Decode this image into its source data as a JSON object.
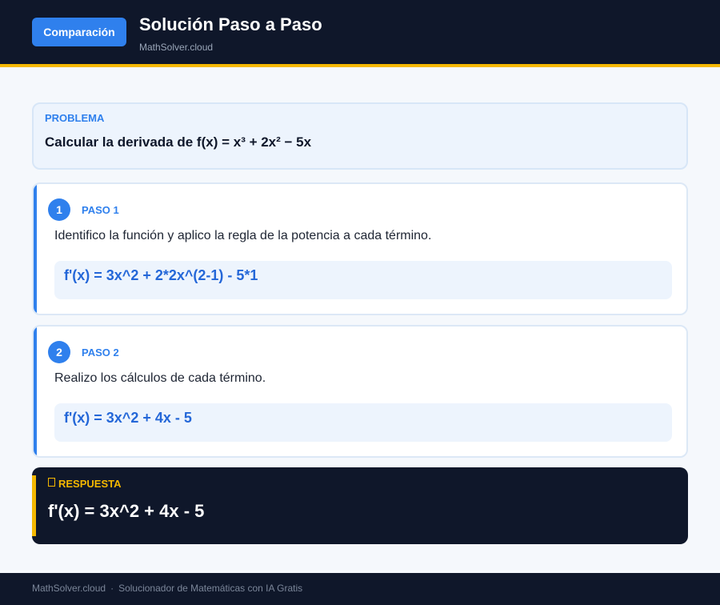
{
  "header": {
    "badge_label": "Comparación",
    "title": "Solución Paso a Paso",
    "subtitle": "MathSolver.cloud"
  },
  "problem": {
    "label": "PROBLEMA",
    "text": "Calcular la derivada de f(x) = x³ + 2x² − 5x"
  },
  "steps": [
    {
      "number": "1",
      "label": "PASO 1",
      "description": "Identifico la función y aplico la regla de la potencia a cada término.",
      "formula": "f'(x) = 3x^2 + 2*2x^(2-1) - 5*1"
    },
    {
      "number": "2",
      "label": "PASO 2",
      "description": "Realizo los cálculos de cada término.",
      "formula": "f'(x) = 3x^2 + 4x - 5"
    }
  ],
  "answer": {
    "icon": "document-icon",
    "label": "RESPUESTA",
    "text": "f'(x) = 3x^2 + 4x - 5"
  },
  "footer": {
    "site": "MathSolver.cloud",
    "separator": "·",
    "tagline": "Solucionador de Matemáticas con IA Gratis"
  },
  "colors": {
    "accent": "#2f80ed",
    "dark": "#0f172a",
    "highlight": "#f5b800"
  }
}
